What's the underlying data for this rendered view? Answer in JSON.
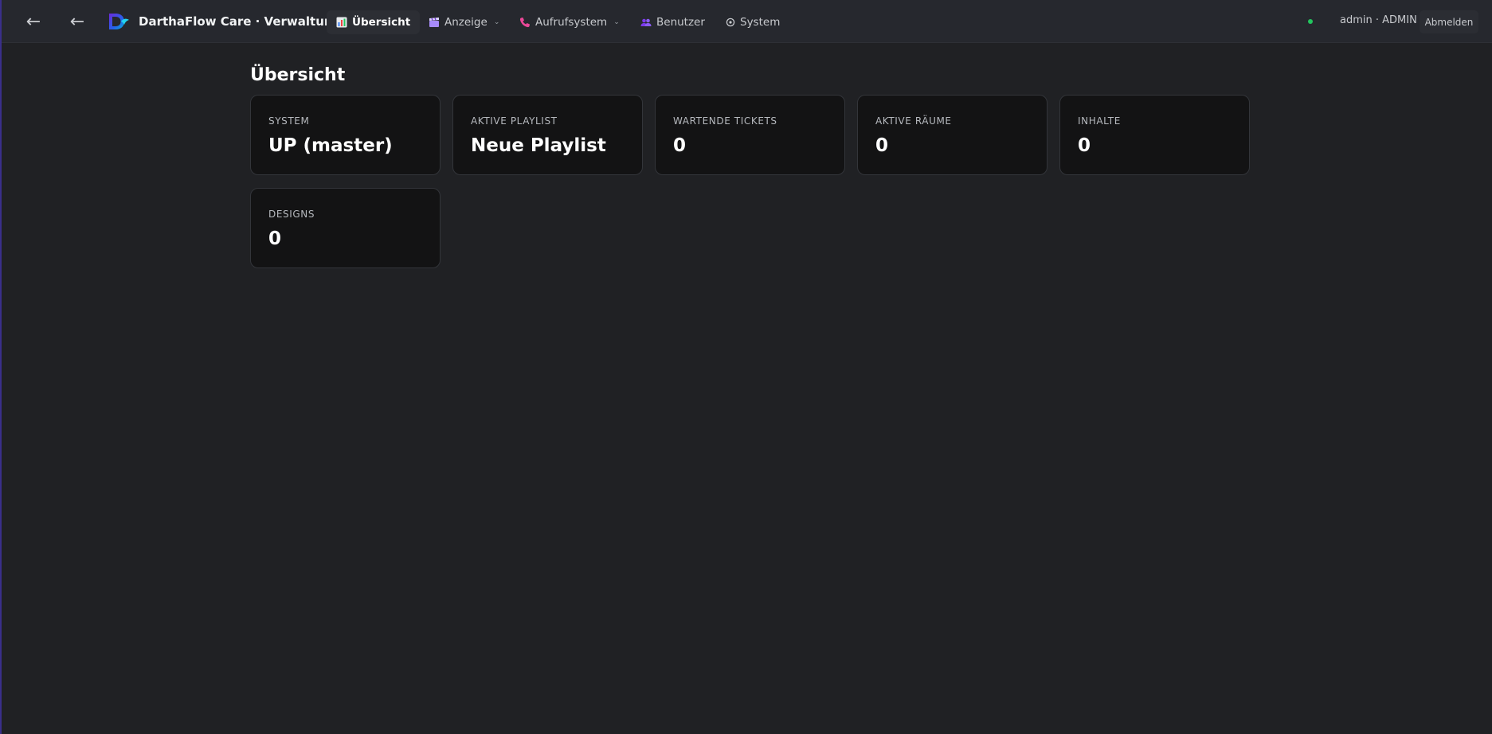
{
  "app": {
    "title": "DarthaFlow Care · Verwaltung"
  },
  "nav": {
    "back_icon": "←",
    "items": [
      {
        "label": "Übersicht",
        "icon": "bar-chart-icon",
        "has_dropdown": false,
        "active": true
      },
      {
        "label": "Anzeige",
        "icon": "clapperboard-icon",
        "has_dropdown": true,
        "active": false
      },
      {
        "label": "Aufrufsystem",
        "icon": "phone-icon",
        "has_dropdown": true,
        "active": false
      },
      {
        "label": "Benutzer",
        "icon": "users-icon",
        "has_dropdown": false,
        "active": false
      },
      {
        "label": "System",
        "icon": "gear-icon",
        "has_dropdown": false,
        "active": false
      }
    ],
    "caret": "⌄"
  },
  "user": {
    "status_color": "#22c55e",
    "label": "admin · ADMIN",
    "logout_label": "Abmelden"
  },
  "page": {
    "title": "Übersicht"
  },
  "cards": [
    {
      "label": "SYSTEM",
      "value": "UP (master)"
    },
    {
      "label": "AKTIVE PLAYLIST",
      "value": "Neue Playlist"
    },
    {
      "label": "WARTENDE TICKETS",
      "value": "0"
    },
    {
      "label": "AKTIVE RÄUME",
      "value": "0"
    },
    {
      "label": "INHALTE",
      "value": "0"
    },
    {
      "label": "DESIGNS",
      "value": "0"
    }
  ],
  "colors": {
    "background": "#202124",
    "topbar": "#26282e",
    "card": "#131314",
    "accent_logo": "#7c3aed"
  }
}
